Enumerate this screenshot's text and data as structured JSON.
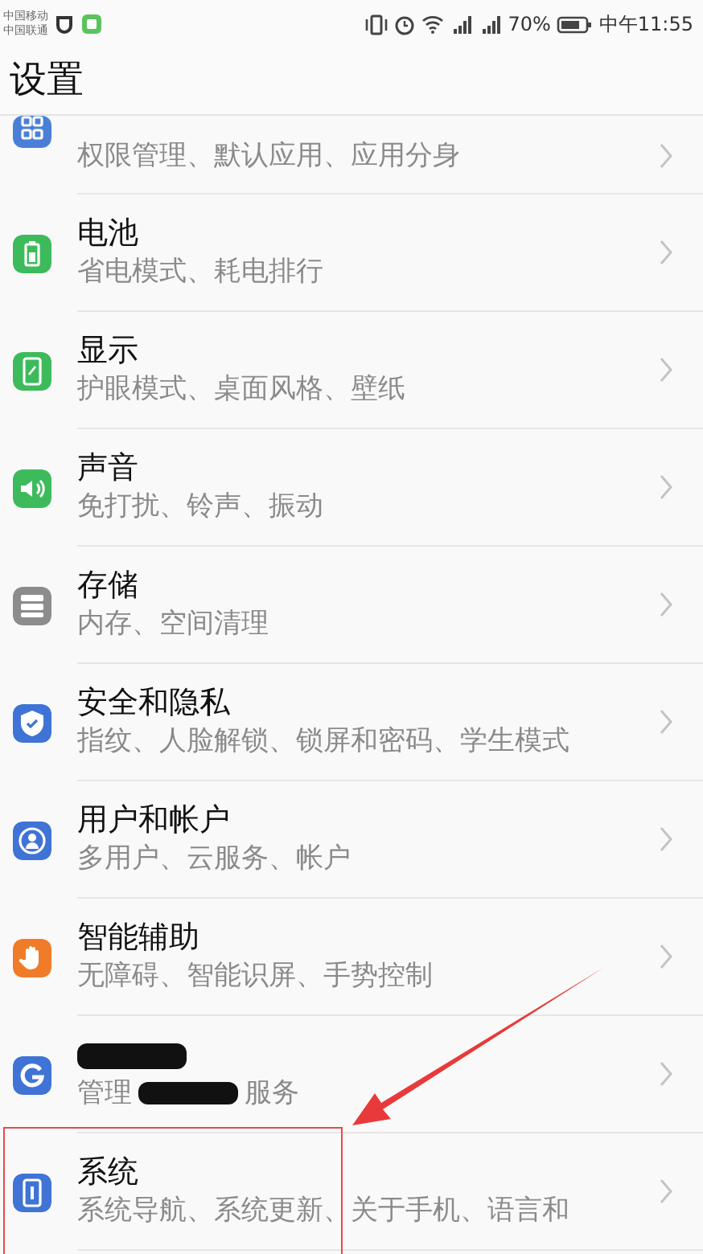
{
  "status_bar": {
    "carriers": [
      "中国移动",
      "中国联通"
    ],
    "battery": "70%",
    "time": "中午11:55"
  },
  "header": {
    "title": "设置"
  },
  "items": [
    {
      "kind": "grid",
      "partial": true,
      "color": "#4a7fd8",
      "subtitle": [
        {
          "kind": "text",
          "text": "权限管理、默认应用、应用分身"
        }
      ]
    },
    {
      "kind": "battery",
      "color": "#3dbb5c",
      "title": "电池",
      "subtitle": [
        {
          "kind": "text",
          "text": "省电模式、耗电排行"
        }
      ]
    },
    {
      "kind": "display",
      "color": "#3dbb5c",
      "title": "显示",
      "subtitle": [
        {
          "kind": "text",
          "text": "护眼模式、桌面风格、壁纸"
        }
      ]
    },
    {
      "kind": "sound",
      "color": "#3dbb5c",
      "title": "声音",
      "subtitle": [
        {
          "kind": "text",
          "text": "免打扰、铃声、振动"
        }
      ]
    },
    {
      "kind": "storage",
      "color": "#8c8c8c",
      "title": "存储",
      "subtitle": [
        {
          "kind": "text",
          "text": "内存、空间清理"
        }
      ]
    },
    {
      "kind": "shield",
      "color": "#3f74d6",
      "title": "安全和隐私",
      "subtitle": [
        {
          "kind": "text",
          "text": "指纹、人脸解锁、锁屏和密码、学生模式"
        }
      ]
    },
    {
      "kind": "user",
      "color": "#3f74d6",
      "title": "用户和帐户",
      "subtitle": [
        {
          "kind": "text",
          "text": "多用户、云服务、帐户"
        }
      ]
    },
    {
      "kind": "hand",
      "color": "#f07c2a",
      "title": "智能辅助",
      "subtitle": [
        {
          "kind": "text",
          "text": "无障碍、智能识屏、手势控制"
        }
      ]
    },
    {
      "kind": "g",
      "color": "#3f74d6",
      "title_redacted": true,
      "subtitle": [
        {
          "kind": "text",
          "text": "管理"
        },
        {
          "kind": "redaction"
        },
        {
          "kind": "text",
          "text": "服务"
        }
      ]
    },
    {
      "kind": "phone",
      "color": "#3f74d6",
      "title": "系统",
      "highlighted": true,
      "subtitle": [
        {
          "kind": "text",
          "text": "系统导航、系统更新、关于手机、语言和"
        }
      ]
    }
  ]
}
